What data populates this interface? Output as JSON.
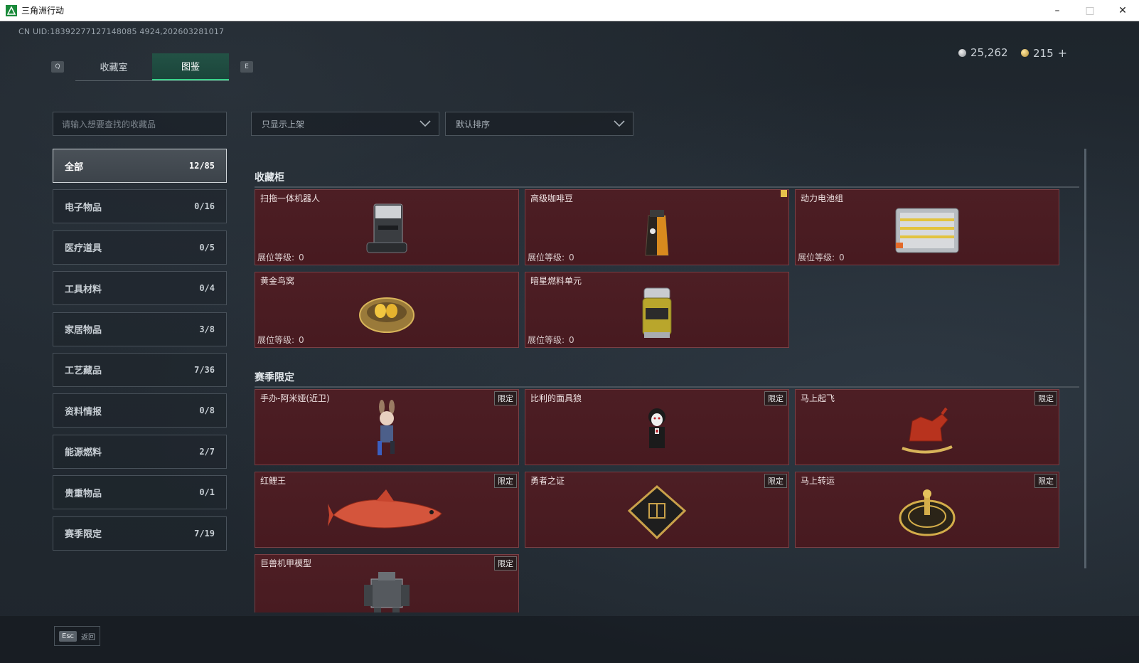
{
  "window": {
    "title": "三角洲行动"
  },
  "uid": "CN UID:18392277127148085 4924,202603281017",
  "nav": {
    "prev_key": "Q",
    "next_key": "E",
    "tabs": [
      {
        "label": "收藏室"
      },
      {
        "label": "图鉴"
      }
    ]
  },
  "currency": {
    "silver": "25,262",
    "gold": "215"
  },
  "search": {
    "placeholder": "请输入想要查找的收藏品"
  },
  "filters": {
    "shelf": "只显示上架",
    "sort": "默认排序"
  },
  "categories": [
    {
      "label": "全部",
      "count": "12/85"
    },
    {
      "label": "电子物品",
      "count": "0/16"
    },
    {
      "label": "医疗道具",
      "count": "0/5"
    },
    {
      "label": "工具材料",
      "count": "0/4"
    },
    {
      "label": "家居物品",
      "count": "3/8"
    },
    {
      "label": "工艺藏品",
      "count": "7/36"
    },
    {
      "label": "资料情报",
      "count": "0/8"
    },
    {
      "label": "能源燃料",
      "count": "2/7"
    },
    {
      "label": "贵重物品",
      "count": "0/1"
    },
    {
      "label": "赛季限定",
      "count": "7/19"
    }
  ],
  "level_label": "展位等级:",
  "limited_tag": "限定",
  "sections": [
    {
      "title": "收藏柜",
      "items": [
        {
          "name": "扫拖一体机器人",
          "level": "0",
          "icon": "robot-vacuum-icon"
        },
        {
          "name": "高级咖啡豆",
          "level": "0",
          "icon": "coffee-beans-icon"
        },
        {
          "name": "动力电池组",
          "level": "0",
          "icon": "battery-pack-icon"
        },
        {
          "name": "黄金鸟窝",
          "level": "0",
          "icon": "golden-nest-icon"
        },
        {
          "name": "暗星燃料单元",
          "level": "0",
          "icon": "fuel-cell-icon"
        }
      ]
    },
    {
      "title": "赛季限定",
      "items": [
        {
          "name": "手办-阿米娅(近卫)",
          "icon": "figure-amiya-icon"
        },
        {
          "name": "比利的面具狼",
          "icon": "billy-puppet-icon"
        },
        {
          "name": "马上起飞",
          "icon": "rocking-horse-icon"
        },
        {
          "name": "红鲤王",
          "icon": "red-carp-icon"
        },
        {
          "name": "勇者之证",
          "icon": "hero-card-icon"
        },
        {
          "name": "马上转运",
          "icon": "golden-wheel-icon"
        },
        {
          "name": "巨兽机甲模型",
          "icon": "mech-model-icon"
        }
      ]
    }
  ],
  "footer": {
    "esc_key": "Esc",
    "back_label": "返回"
  }
}
